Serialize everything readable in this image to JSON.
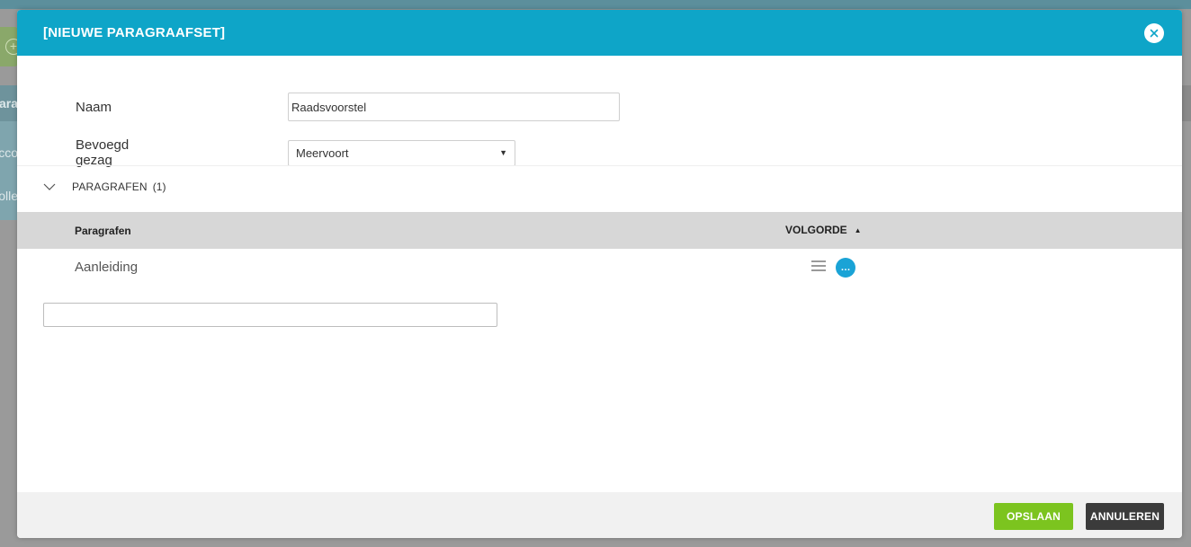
{
  "background": {
    "side_items": [
      "Para",
      "Acco",
      "Rolle"
    ]
  },
  "modal": {
    "title": "[NIEUWE PARAGRAAFSET]",
    "close_icon": "close-icon"
  },
  "form": {
    "name_label": "Naam",
    "name_value": "Raadsvoorstel",
    "authority_label": "Bevoegd gezag",
    "authority_value": "Meervoort"
  },
  "section": {
    "title": "PARAGRAFEN",
    "count": "(1)"
  },
  "table": {
    "columns": [
      "Paragrafen",
      "VOLGORDE"
    ],
    "rows": [
      {
        "name": "Aanleiding"
      }
    ]
  },
  "add_input": {
    "value": ""
  },
  "footer": {
    "save_label": "OPSLAAN",
    "cancel_label": "ANNULEREN"
  },
  "colors": {
    "header": "#0ea5c8",
    "save": "#7cc41f",
    "cancel": "#3b3b3b",
    "more": "#1aa3d6"
  }
}
